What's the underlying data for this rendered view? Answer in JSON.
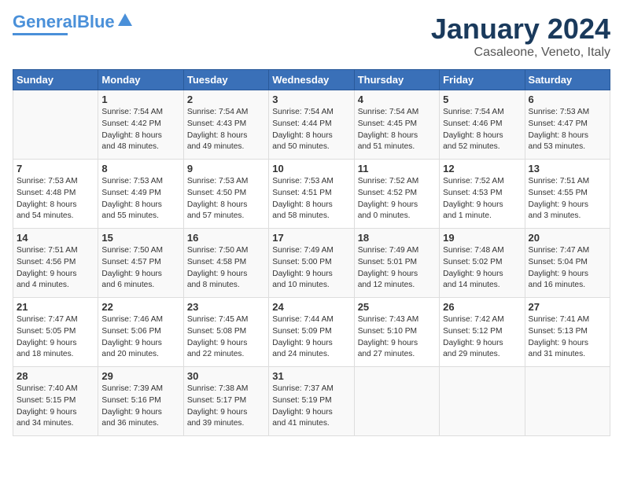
{
  "header": {
    "logo_line1": "General",
    "logo_line2": "Blue",
    "month_title": "January 2024",
    "subtitle": "Casaleone, Veneto, Italy"
  },
  "days_of_week": [
    "Sunday",
    "Monday",
    "Tuesday",
    "Wednesday",
    "Thursday",
    "Friday",
    "Saturday"
  ],
  "weeks": [
    [
      {
        "day": "",
        "info": ""
      },
      {
        "day": "1",
        "info": "Sunrise: 7:54 AM\nSunset: 4:42 PM\nDaylight: 8 hours\nand 48 minutes."
      },
      {
        "day": "2",
        "info": "Sunrise: 7:54 AM\nSunset: 4:43 PM\nDaylight: 8 hours\nand 49 minutes."
      },
      {
        "day": "3",
        "info": "Sunrise: 7:54 AM\nSunset: 4:44 PM\nDaylight: 8 hours\nand 50 minutes."
      },
      {
        "day": "4",
        "info": "Sunrise: 7:54 AM\nSunset: 4:45 PM\nDaylight: 8 hours\nand 51 minutes."
      },
      {
        "day": "5",
        "info": "Sunrise: 7:54 AM\nSunset: 4:46 PM\nDaylight: 8 hours\nand 52 minutes."
      },
      {
        "day": "6",
        "info": "Sunrise: 7:53 AM\nSunset: 4:47 PM\nDaylight: 8 hours\nand 53 minutes."
      }
    ],
    [
      {
        "day": "7",
        "info": "Sunrise: 7:53 AM\nSunset: 4:48 PM\nDaylight: 8 hours\nand 54 minutes."
      },
      {
        "day": "8",
        "info": "Sunrise: 7:53 AM\nSunset: 4:49 PM\nDaylight: 8 hours\nand 55 minutes."
      },
      {
        "day": "9",
        "info": "Sunrise: 7:53 AM\nSunset: 4:50 PM\nDaylight: 8 hours\nand 57 minutes."
      },
      {
        "day": "10",
        "info": "Sunrise: 7:53 AM\nSunset: 4:51 PM\nDaylight: 8 hours\nand 58 minutes."
      },
      {
        "day": "11",
        "info": "Sunrise: 7:52 AM\nSunset: 4:52 PM\nDaylight: 9 hours\nand 0 minutes."
      },
      {
        "day": "12",
        "info": "Sunrise: 7:52 AM\nSunset: 4:53 PM\nDaylight: 9 hours\nand 1 minute."
      },
      {
        "day": "13",
        "info": "Sunrise: 7:51 AM\nSunset: 4:55 PM\nDaylight: 9 hours\nand 3 minutes."
      }
    ],
    [
      {
        "day": "14",
        "info": "Sunrise: 7:51 AM\nSunset: 4:56 PM\nDaylight: 9 hours\nand 4 minutes."
      },
      {
        "day": "15",
        "info": "Sunrise: 7:50 AM\nSunset: 4:57 PM\nDaylight: 9 hours\nand 6 minutes."
      },
      {
        "day": "16",
        "info": "Sunrise: 7:50 AM\nSunset: 4:58 PM\nDaylight: 9 hours\nand 8 minutes."
      },
      {
        "day": "17",
        "info": "Sunrise: 7:49 AM\nSunset: 5:00 PM\nDaylight: 9 hours\nand 10 minutes."
      },
      {
        "day": "18",
        "info": "Sunrise: 7:49 AM\nSunset: 5:01 PM\nDaylight: 9 hours\nand 12 minutes."
      },
      {
        "day": "19",
        "info": "Sunrise: 7:48 AM\nSunset: 5:02 PM\nDaylight: 9 hours\nand 14 minutes."
      },
      {
        "day": "20",
        "info": "Sunrise: 7:47 AM\nSunset: 5:04 PM\nDaylight: 9 hours\nand 16 minutes."
      }
    ],
    [
      {
        "day": "21",
        "info": "Sunrise: 7:47 AM\nSunset: 5:05 PM\nDaylight: 9 hours\nand 18 minutes."
      },
      {
        "day": "22",
        "info": "Sunrise: 7:46 AM\nSunset: 5:06 PM\nDaylight: 9 hours\nand 20 minutes."
      },
      {
        "day": "23",
        "info": "Sunrise: 7:45 AM\nSunset: 5:08 PM\nDaylight: 9 hours\nand 22 minutes."
      },
      {
        "day": "24",
        "info": "Sunrise: 7:44 AM\nSunset: 5:09 PM\nDaylight: 9 hours\nand 24 minutes."
      },
      {
        "day": "25",
        "info": "Sunrise: 7:43 AM\nSunset: 5:10 PM\nDaylight: 9 hours\nand 27 minutes."
      },
      {
        "day": "26",
        "info": "Sunrise: 7:42 AM\nSunset: 5:12 PM\nDaylight: 9 hours\nand 29 minutes."
      },
      {
        "day": "27",
        "info": "Sunrise: 7:41 AM\nSunset: 5:13 PM\nDaylight: 9 hours\nand 31 minutes."
      }
    ],
    [
      {
        "day": "28",
        "info": "Sunrise: 7:40 AM\nSunset: 5:15 PM\nDaylight: 9 hours\nand 34 minutes."
      },
      {
        "day": "29",
        "info": "Sunrise: 7:39 AM\nSunset: 5:16 PM\nDaylight: 9 hours\nand 36 minutes."
      },
      {
        "day": "30",
        "info": "Sunrise: 7:38 AM\nSunset: 5:17 PM\nDaylight: 9 hours\nand 39 minutes."
      },
      {
        "day": "31",
        "info": "Sunrise: 7:37 AM\nSunset: 5:19 PM\nDaylight: 9 hours\nand 41 minutes."
      },
      {
        "day": "",
        "info": ""
      },
      {
        "day": "",
        "info": ""
      },
      {
        "day": "",
        "info": ""
      }
    ]
  ]
}
